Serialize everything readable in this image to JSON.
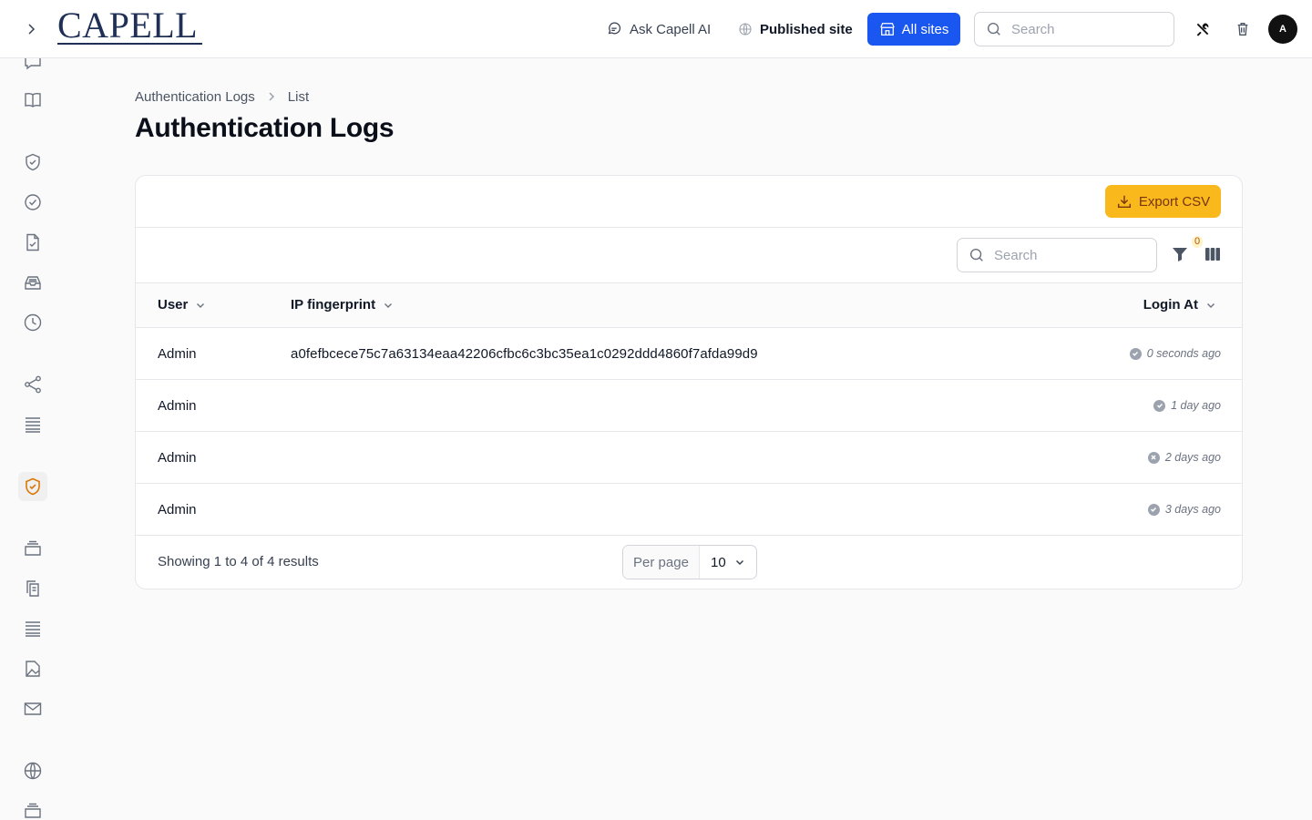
{
  "header": {
    "brand": "CAPELL",
    "ask_ai_label": "Ask Capell AI",
    "published_site_label": "Published site",
    "all_sites_label": "All sites",
    "search_placeholder": "Search",
    "avatar_initial": "A"
  },
  "sidebar": {
    "icons": [
      "chat-icon",
      "book-icon",
      "shield-check-icon",
      "check-circle-icon",
      "file-check-icon",
      "inbox-icon",
      "clock-icon",
      "share-icon",
      "list-icon",
      "shield-check-active-icon",
      "archive-icon",
      "copy-icon",
      "list-icon",
      "image-file-icon",
      "mail-icon",
      "globe-icon",
      "archive-icon"
    ],
    "active_index": 9
  },
  "breadcrumb": {
    "parent": "Authentication Logs",
    "current": "List"
  },
  "page": {
    "title": "Authentication Logs"
  },
  "table": {
    "export_label": "Export CSV",
    "search_placeholder": "Search",
    "filter_count": "0",
    "columns": {
      "user": "User",
      "ip": "IP fingerprint",
      "login": "Login At"
    },
    "rows": [
      {
        "user": "Admin",
        "ip": "a0fefbcece75c7a63134eaa42206cfbc6c3bc35ea1c0292ddd4860f7afda99d9",
        "login": "0 seconds ago",
        "status": "check"
      },
      {
        "user": "Admin",
        "ip": "",
        "login": "1 day ago",
        "status": "check"
      },
      {
        "user": "Admin",
        "ip": "",
        "login": "2 days ago",
        "status": "x"
      },
      {
        "user": "Admin",
        "ip": "",
        "login": "3 days ago",
        "status": "check"
      }
    ],
    "footer": {
      "results_text": "Showing 1 to 4 of 4 results",
      "per_page_label": "Per page",
      "per_page_value": "10"
    }
  },
  "colors": {
    "primary": "#1a56f0",
    "export": "#f9b81c",
    "active_icon": "#d97706"
  }
}
